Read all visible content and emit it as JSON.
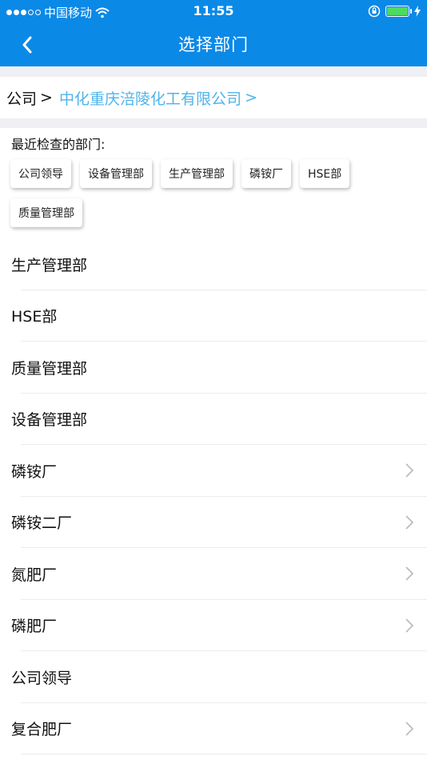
{
  "status_bar": {
    "carrier": "中国移动",
    "time": "11:55"
  },
  "nav": {
    "title": "选择部门"
  },
  "breadcrumb": {
    "root": "公司",
    "separator": ">",
    "company": "中化重庆涪陵化工有限公司",
    "company_separator": ">"
  },
  "recent": {
    "title": "最近检查的部门:",
    "chips": [
      "公司领导",
      "设备管理部",
      "生产管理部",
      "磷铵厂",
      "HSE部",
      "质量管理部"
    ]
  },
  "departments": [
    {
      "label": "生产管理部",
      "has_children": false
    },
    {
      "label": "HSE部",
      "has_children": false
    },
    {
      "label": "质量管理部",
      "has_children": false
    },
    {
      "label": "设备管理部",
      "has_children": false
    },
    {
      "label": "磷铵厂",
      "has_children": true
    },
    {
      "label": "磷铵二厂",
      "has_children": true
    },
    {
      "label": "氮肥厂",
      "has_children": true
    },
    {
      "label": "磷肥厂",
      "has_children": true
    },
    {
      "label": "公司领导",
      "has_children": false
    },
    {
      "label": "复合肥厂",
      "has_children": true
    }
  ],
  "colors": {
    "nav_background": "#0b89e7",
    "company_link": "#4fb3ea",
    "battery": "#4cd964",
    "section_gap": "#efeff4"
  },
  "icons": {
    "back": "chevron-left-icon",
    "row_disclosure": "chevron-right-icon",
    "wifi": "wifi-icon",
    "lock": "orientation-lock-icon",
    "battery": "battery-icon",
    "charging": "charging-bolt-icon"
  }
}
